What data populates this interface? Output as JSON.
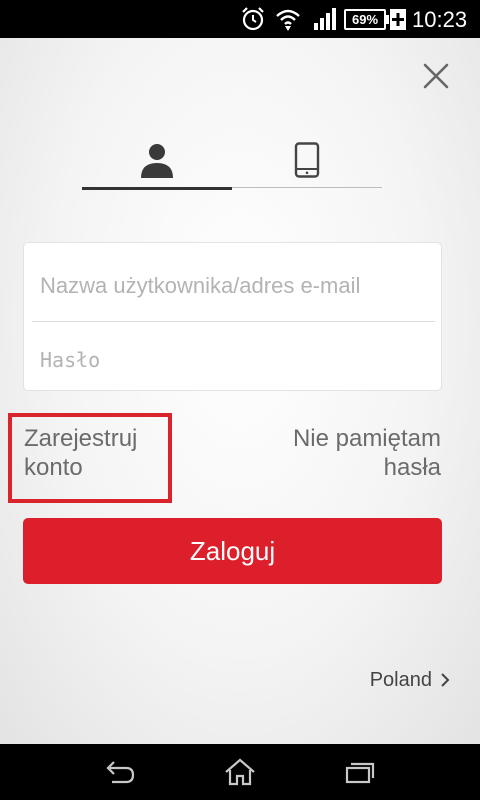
{
  "status_bar": {
    "battery_level": "69%",
    "time": "10:23"
  },
  "tabs": [
    {
      "icon": "person-icon",
      "active": true
    },
    {
      "icon": "phone-icon",
      "active": false
    }
  ],
  "form": {
    "username_placeholder": "Nazwa użytkownika/adres e-mail",
    "password_placeholder": "Hasło"
  },
  "links": {
    "register_line1": "Zarejestruj",
    "register_line2": "konto",
    "forgot_line1": "Nie pamiętam",
    "forgot_line2": "hasła"
  },
  "login_button_label": "Zaloguj",
  "region": {
    "label": "Poland",
    "icon": "chevron-right-icon"
  },
  "colors": {
    "accent": "#dc1f2a",
    "highlight": "#d9232d"
  }
}
